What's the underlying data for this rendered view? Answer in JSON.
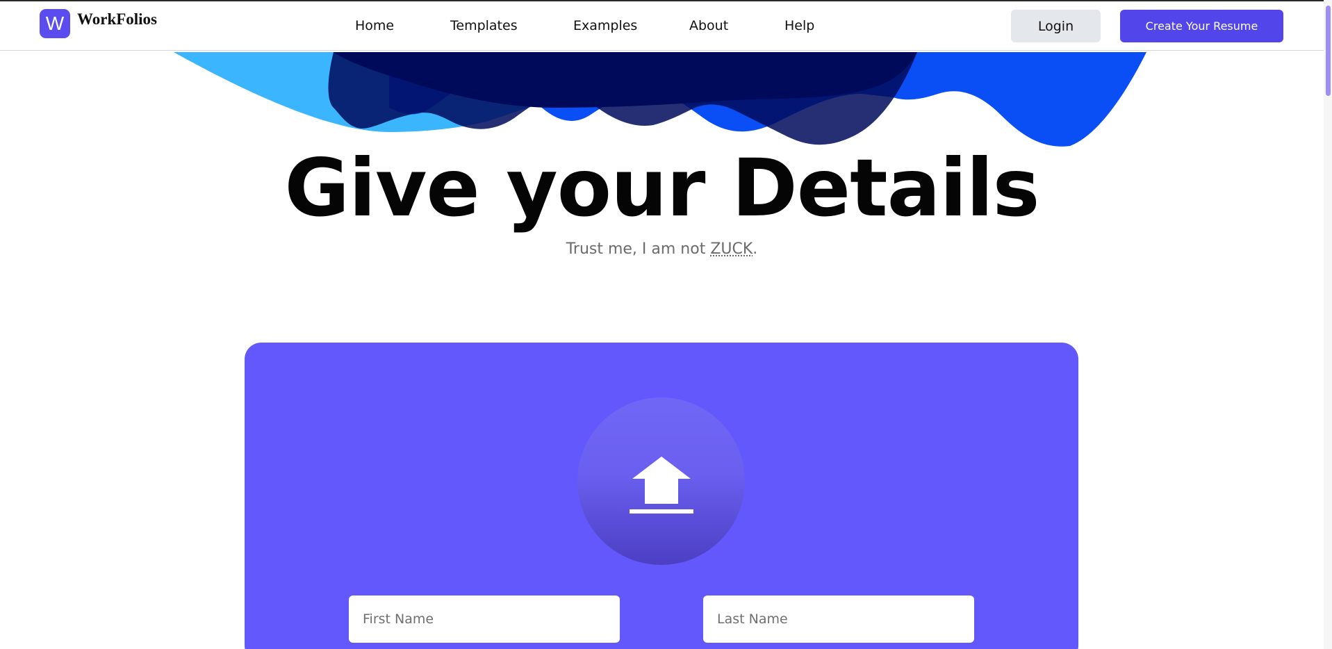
{
  "brand": {
    "logo_letter": "W",
    "name": "WorkFolios",
    "color": "#5b4cf0"
  },
  "nav": {
    "links": [
      "Home",
      "Templates",
      "Examples",
      "About",
      "Help"
    ],
    "login_label": "Login",
    "create_label": "Create Your Resume"
  },
  "hero": {
    "title": "Give your Details",
    "subtitle_prefix": "Trust me, I am not ",
    "subtitle_abbr": "ZUCK",
    "subtitle_suffix": "."
  },
  "form": {
    "upload_icon": "upload-icon",
    "first_name_placeholder": "First Name",
    "last_name_placeholder": "Last Name",
    "panel_color": "#6358fc"
  },
  "colors": {
    "accent": "#5246ea",
    "wave_light": "#3bb5fd",
    "wave_blue": "#0a4ff5",
    "wave_navy": "#010a5c"
  }
}
